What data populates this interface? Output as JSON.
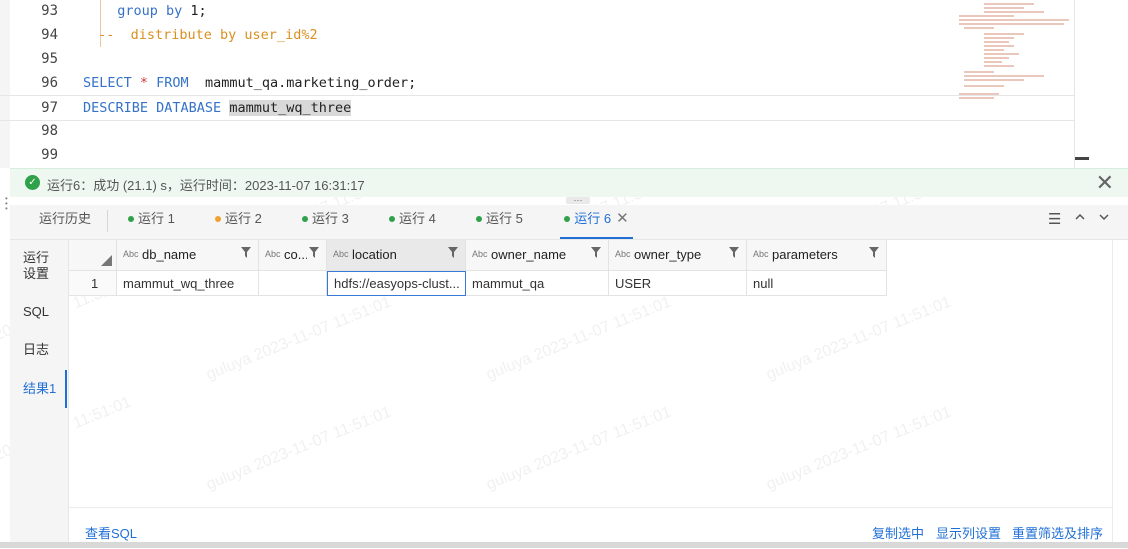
{
  "editor": {
    "lines": [
      {
        "number": "93",
        "segments": [
          {
            "text": "  ",
            "cls": ""
          },
          {
            "text": "group by ",
            "cls": "kw"
          },
          {
            "text": "1;",
            "cls": ""
          }
        ]
      },
      {
        "number": "94",
        "segments": [
          {
            "text": " --  distribute by user_id%2",
            "cls": "cmt"
          }
        ]
      },
      {
        "number": "95",
        "segments": []
      },
      {
        "number": "96",
        "segments": [
          {
            "text": "SELECT ",
            "cls": "kw"
          },
          {
            "text": "*",
            "cls": "op"
          },
          {
            "text": " FROM ",
            "cls": "kw"
          },
          {
            "text": " mammut_qa.marketing_order;",
            "cls": ""
          }
        ]
      },
      {
        "number": "97",
        "segments": [
          {
            "text": "DESCRIBE DATABASE ",
            "cls": "kw"
          },
          {
            "text": "mammut_wq_three",
            "cls": "sel"
          }
        ]
      },
      {
        "number": "98",
        "segments": []
      },
      {
        "number": "99",
        "segments": []
      }
    ]
  },
  "status": {
    "icon": "check-circle-icon",
    "text": "运行6：成功 (21.1) s，运行时间：2023-11-07 16:31:17",
    "close_icon": "close-icon",
    "color": "#2fa14a"
  },
  "tabs": {
    "history_label": "运行历史",
    "items": [
      {
        "label": "运行 1",
        "dot_color": "#2fa14a"
      },
      {
        "label": "运行 2",
        "dot_color": "#f0a030"
      },
      {
        "label": "运行 3",
        "dot_color": "#2fa14a"
      },
      {
        "label": "运行 4",
        "dot_color": "#2fa14a"
      },
      {
        "label": "运行 5",
        "dot_color": "#2fa14a"
      },
      {
        "label": "运行 6",
        "dot_color": "#2fa14a"
      }
    ],
    "active_index": 5,
    "close_glyph": "✕",
    "icons": [
      "menu-icon",
      "chevron-up-icon",
      "chevron-down-icon"
    ]
  },
  "sidenav": {
    "items": [
      "运行设置",
      "SQL",
      "日志",
      "结果1"
    ],
    "active": "结果1"
  },
  "result": {
    "type_badge": "Abc",
    "columns": [
      "db_name",
      "co...",
      "location",
      "owner_name",
      "owner_type",
      "parameters"
    ],
    "rows": [
      {
        "index": "1",
        "cells": [
          "mammut_wq_three",
          "",
          "hdfs://easyops-clust...",
          "mammut_qa",
          "USER",
          "null"
        ]
      }
    ]
  },
  "footer": {
    "view_sql": "查看SQL",
    "copy_selected": "复制选中",
    "column_settings": "显示列设置",
    "reset_filter_sort": "重置筛选及排序"
  },
  "watermark": "guluya 2023-11-07 11:51:01",
  "colors": {
    "accent": "#1f6fd6",
    "success": "#2fa14a",
    "warning": "#f0a030",
    "keyword": "#3572c8",
    "comment": "#d99022"
  }
}
